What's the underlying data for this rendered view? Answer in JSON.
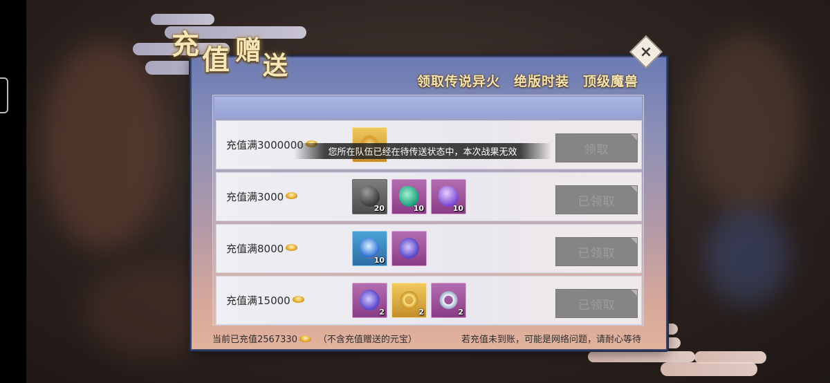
{
  "title": {
    "chars": [
      "充",
      "值",
      "赠",
      "送"
    ]
  },
  "banner": [
    "领取传说异火",
    "绝版时装",
    "顶级魔兽"
  ],
  "close_label": "×",
  "toast": "您所在队伍已经在待传送状态中，本次战果无效",
  "rows": [
    {
      "label": "充值满3000000",
      "button": "领取",
      "items": [
        {
          "icon": "golden-flame-icon",
          "qty": ""
        }
      ]
    },
    {
      "label": "充值满3000",
      "button": "已领取",
      "items": [
        {
          "icon": "gray-ore-icon",
          "qty": "20"
        },
        {
          "icon": "jade-crystal-icon",
          "qty": "10"
        },
        {
          "icon": "violet-crystal-icon",
          "qty": "10"
        }
      ]
    },
    {
      "label": "充值满8000",
      "button": "已领取",
      "items": [
        {
          "icon": "azure-flame-gem-icon",
          "qty": "10"
        },
        {
          "icon": "purple-pouch-icon",
          "qty": ""
        }
      ]
    },
    {
      "label": "充值满15000",
      "button": "已领取",
      "items": [
        {
          "icon": "purple-pouch-icon",
          "qty": "2"
        },
        {
          "icon": "gold-ring-icon",
          "qty": "2"
        },
        {
          "icon": "silver-ring-icon",
          "qty": "2"
        }
      ]
    }
  ],
  "footer": {
    "recharged": "当前已充值2567330",
    "note": "（不含充值赠送的元宝）",
    "hint": "若充值未到账，可能是网络问题，请耐心等待"
  },
  "colors": {
    "currency": "#e0a72a",
    "claim_disabled": "#858585"
  }
}
